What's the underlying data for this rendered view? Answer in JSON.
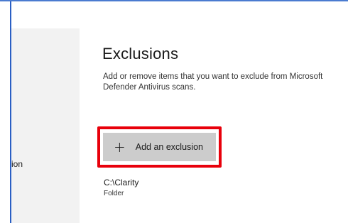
{
  "sidebar": {
    "item_fragment": "ion"
  },
  "main": {
    "title": "Exclusions",
    "description": "Add or remove items that you want to exclude from Microsoft Defender Antivirus scans.",
    "add_button": {
      "icon": "plus-icon",
      "label": "Add an exclusion"
    },
    "exclusions": [
      {
        "path": "C:\\Clarity",
        "type": "Folder"
      }
    ]
  },
  "colors": {
    "accent_border": "#2a5fc4",
    "highlight": "#e8000b",
    "button_bg": "#cccccc"
  }
}
